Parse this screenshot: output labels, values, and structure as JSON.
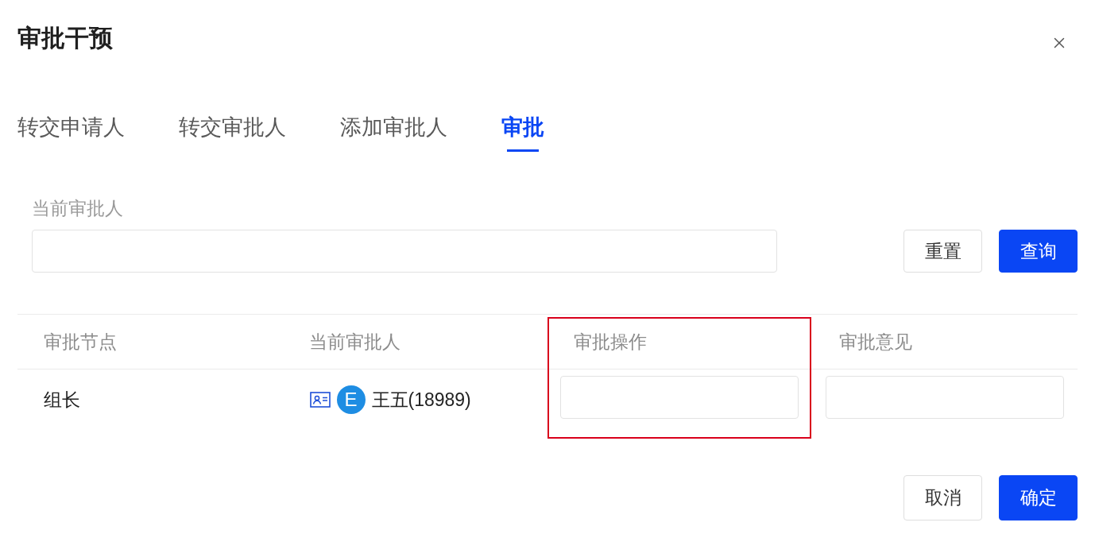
{
  "dialog": {
    "title": "审批干预"
  },
  "tabs": [
    {
      "label": "转交申请人",
      "selected": false
    },
    {
      "label": "转交审批人",
      "selected": false
    },
    {
      "label": "添加审批人",
      "selected": false
    },
    {
      "label": "审批",
      "selected": true
    }
  ],
  "filter": {
    "label": "当前审批人",
    "buttons": [
      {
        "label": "重置",
        "kind": "default"
      },
      {
        "label": "查询",
        "kind": "primary"
      }
    ]
  },
  "table": {
    "columns": [
      {
        "label": "审批节点",
        "highlighted": false
      },
      {
        "label": "当前审批人",
        "highlighted": false
      },
      {
        "label": "审批操作",
        "highlighted": true
      },
      {
        "label": "审批意见",
        "highlighted": false
      }
    ],
    "rows": [
      {
        "cells": [
          {
            "kind": "text",
            "text": "组长"
          },
          {
            "kind": "person",
            "avatar": "E",
            "name": "王五(18989)"
          },
          {
            "kind": "input"
          },
          {
            "kind": "input"
          }
        ]
      }
    ]
  },
  "footer": {
    "buttons": [
      {
        "label": "取消",
        "kind": "default"
      },
      {
        "label": "确定",
        "kind": "primary"
      }
    ]
  }
}
